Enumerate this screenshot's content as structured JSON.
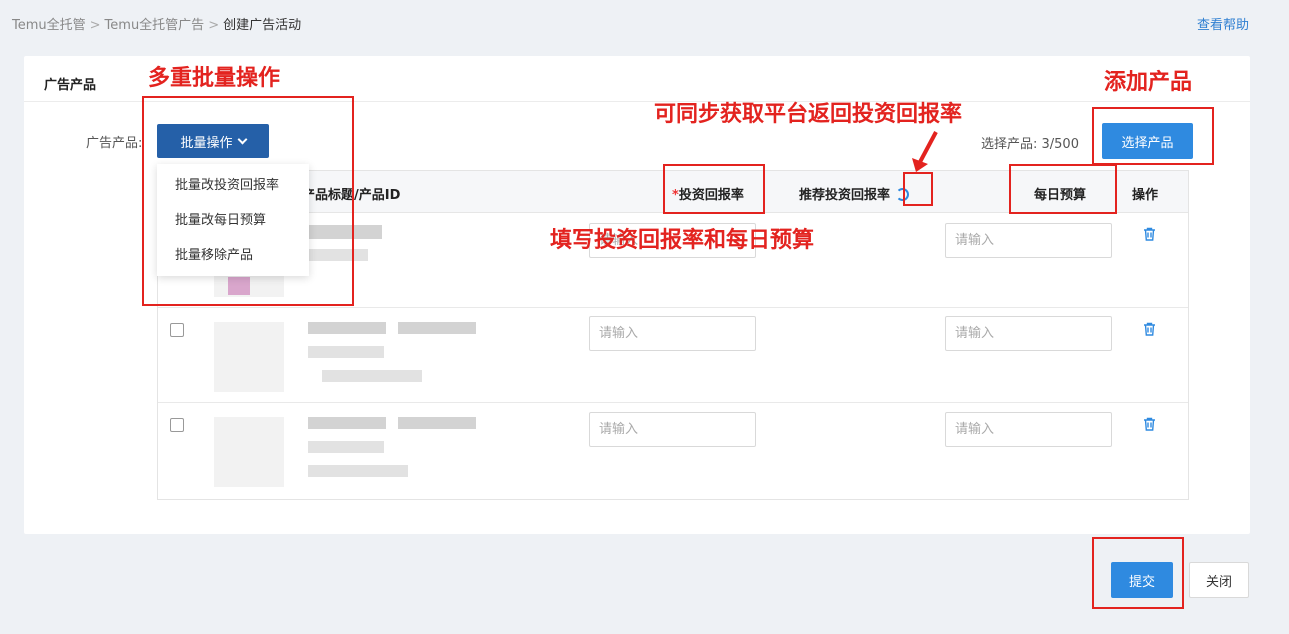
{
  "breadcrumb": {
    "items": [
      "Temu全托管",
      "Temu全托管广告",
      "创建广告活动"
    ],
    "separator": ">"
  },
  "header_links": {
    "help": "查看帮助"
  },
  "card": {
    "title": "广告产品"
  },
  "form": {
    "label": "广告产品:",
    "batch_button": "批量操作",
    "batch_menu": [
      "批量改投资回报率",
      "批量改每日预算",
      "批量移除产品"
    ],
    "selected_count": "选择产品: 3/500",
    "select_button": "选择产品"
  },
  "table": {
    "columns": {
      "title": "产品标题/产品ID",
      "roi_required_mark": "*",
      "roi": "投资回报率",
      "recommended_roi": "推荐投资回报率",
      "daily_budget": "每日预算",
      "actions": "操作"
    },
    "rows": [
      {
        "roi_placeholder": "请输入",
        "budget_placeholder": "请输入"
      },
      {
        "roi_placeholder": "请输入",
        "budget_placeholder": "请输入"
      },
      {
        "roi_placeholder": "请输入",
        "budget_placeholder": "请输入"
      }
    ]
  },
  "footer": {
    "submit": "提交",
    "close": "关闭"
  },
  "annotations": {
    "batch_ops": "多重批量操作",
    "add_product": "添加产品",
    "sync_roi": "可同步获取平台返回投资回报率",
    "fill_in": "填写投资回报率和每日预算"
  },
  "colors": {
    "primary": "#2f8ae0",
    "primary_dark": "#2560a8",
    "annotation_red": "#e3231f"
  },
  "icons": [
    "refresh-icon",
    "trash-icon",
    "chevron-down-icon"
  ]
}
